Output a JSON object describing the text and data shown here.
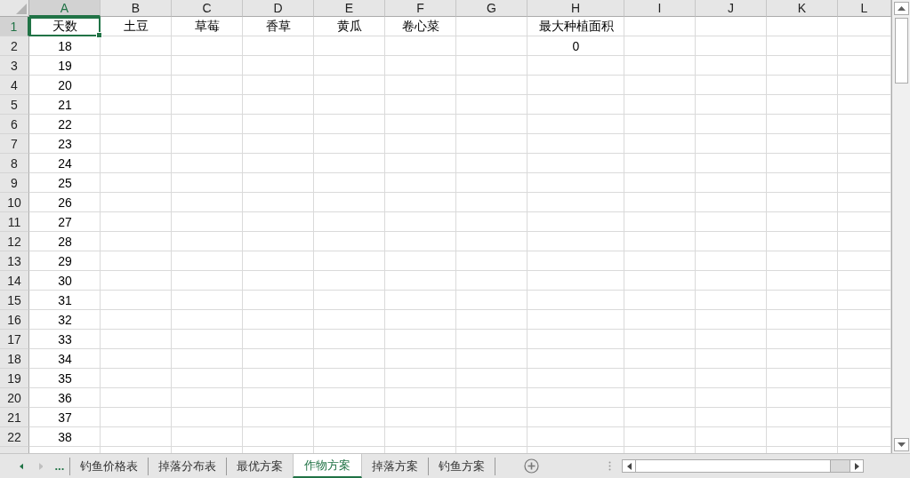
{
  "columns": [
    {
      "label": "A",
      "selected": true
    },
    {
      "label": "B",
      "selected": false
    },
    {
      "label": "C",
      "selected": false
    },
    {
      "label": "D",
      "selected": false
    },
    {
      "label": "E",
      "selected": false
    },
    {
      "label": "F",
      "selected": false
    },
    {
      "label": "G",
      "selected": false
    },
    {
      "label": "H",
      "selected": false
    },
    {
      "label": "I",
      "selected": false
    },
    {
      "label": "J",
      "selected": false
    },
    {
      "label": "K",
      "selected": false
    },
    {
      "label": "L",
      "selected": false
    }
  ],
  "rows": [
    {
      "label": "1",
      "selected": true,
      "cells": [
        "天数",
        "土豆",
        "草莓",
        "香草",
        "黄瓜",
        "卷心菜",
        null,
        "最大种植面积"
      ]
    },
    {
      "label": "2",
      "selected": false,
      "cells": [
        "18",
        null,
        null,
        null,
        null,
        null,
        null,
        "0"
      ]
    },
    {
      "label": "3",
      "selected": false,
      "cells": [
        "19"
      ]
    },
    {
      "label": "4",
      "selected": false,
      "cells": [
        "20"
      ]
    },
    {
      "label": "5",
      "selected": false,
      "cells": [
        "21"
      ]
    },
    {
      "label": "6",
      "selected": false,
      "cells": [
        "22"
      ]
    },
    {
      "label": "7",
      "selected": false,
      "cells": [
        "23"
      ]
    },
    {
      "label": "8",
      "selected": false,
      "cells": [
        "24"
      ]
    },
    {
      "label": "9",
      "selected": false,
      "cells": [
        "25"
      ]
    },
    {
      "label": "10",
      "selected": false,
      "cells": [
        "26"
      ]
    },
    {
      "label": "11",
      "selected": false,
      "cells": [
        "27"
      ]
    },
    {
      "label": "12",
      "selected": false,
      "cells": [
        "28"
      ]
    },
    {
      "label": "13",
      "selected": false,
      "cells": [
        "29"
      ]
    },
    {
      "label": "14",
      "selected": false,
      "cells": [
        "30"
      ]
    },
    {
      "label": "15",
      "selected": false,
      "cells": [
        "31"
      ]
    },
    {
      "label": "16",
      "selected": false,
      "cells": [
        "32"
      ]
    },
    {
      "label": "17",
      "selected": false,
      "cells": [
        "33"
      ]
    },
    {
      "label": "18",
      "selected": false,
      "cells": [
        "34"
      ]
    },
    {
      "label": "19",
      "selected": false,
      "cells": [
        "35"
      ]
    },
    {
      "label": "20",
      "selected": false,
      "cells": [
        "36"
      ]
    },
    {
      "label": "21",
      "selected": false,
      "cells": [
        "37"
      ]
    },
    {
      "label": "22",
      "selected": false,
      "cells": [
        "38"
      ]
    }
  ],
  "sheet_tabs": {
    "more": "...",
    "tabs": [
      {
        "label": "钓鱼价格表",
        "selected": false
      },
      {
        "label": "掉落分布表",
        "selected": false
      },
      {
        "label": "最优方案",
        "selected": false
      },
      {
        "label": "作物方案",
        "selected": true
      },
      {
        "label": "掉落方案",
        "selected": false
      },
      {
        "label": "钓鱼方案",
        "selected": false
      }
    ]
  }
}
